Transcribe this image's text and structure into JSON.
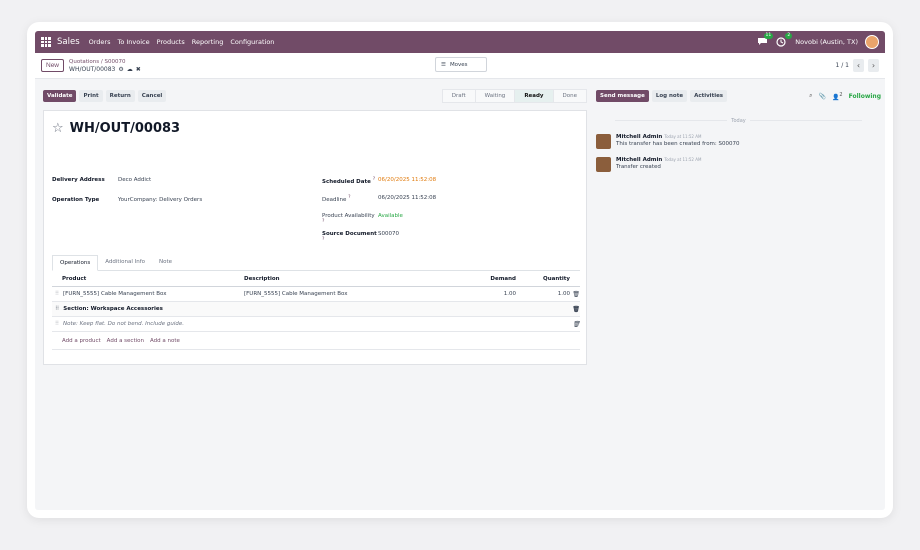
{
  "navbar": {
    "app_name": "Sales",
    "menus": [
      "Orders",
      "To Invoice",
      "Products",
      "Reporting",
      "Configuration"
    ],
    "chat_badge": "11",
    "activity_badge": "2",
    "company": "Novobi (Austin, TX)"
  },
  "control": {
    "new_label": "New",
    "breadcrumb_parent": "Quotations",
    "breadcrumb_sep": "/",
    "breadcrumb_order": "S00070",
    "current_record": "WH/OUT/00083",
    "moves_label": "Moves",
    "pager": "1 / 1"
  },
  "status": {
    "buttons": [
      "Validate",
      "Print",
      "Return",
      "Cancel"
    ],
    "stages": [
      "Draft",
      "Waiting",
      "Ready",
      "Done"
    ],
    "active_stage": "Ready"
  },
  "form": {
    "title": "WH/OUT/00083",
    "delivery_address_label": "Delivery Address",
    "delivery_address": "Deco Addict",
    "operation_type_label": "Operation Type",
    "operation_type": "YourCompany: Delivery Orders",
    "scheduled_date_label": "Scheduled Date",
    "scheduled_date": "06/20/2025 11:52:08",
    "deadline_label": "Deadline",
    "deadline": "06/20/2025 11:52:08",
    "availability_label": "Product Availability",
    "availability": "Available",
    "source_doc_label": "Source Document",
    "source_doc": "S00070",
    "help_mark": "?"
  },
  "tabs": [
    "Operations",
    "Additional Info",
    "Note"
  ],
  "table": {
    "headers": [
      "Product",
      "Description",
      "Demand",
      "Quantity"
    ],
    "row": {
      "product": "[FURN_5555] Cable Management Box",
      "description": "[FURN_5555] Cable Management Box",
      "demand": "1.00",
      "quantity": "1.00"
    },
    "section": "Section: Workspace Accessories",
    "note": "Note: Keep flat. Do not bend. Include guide.",
    "add_links": [
      "Add a product",
      "Add a section",
      "Add a note"
    ]
  },
  "chatter": {
    "buttons": [
      "Send message",
      "Log note",
      "Activities"
    ],
    "followers_count": "2",
    "following_label": "Following",
    "today": "Today",
    "messages": [
      {
        "author": "Mitchell Admin",
        "time": "Today at 11:52 AM",
        "body": "This transfer has been created from: S00070"
      },
      {
        "author": "Mitchell Admin",
        "time": "Today at 11:52 AM",
        "body": "Transfer created"
      }
    ]
  },
  "colors": {
    "brand": "#714b67",
    "success": "#28a745",
    "warning": "#e07a0c"
  }
}
